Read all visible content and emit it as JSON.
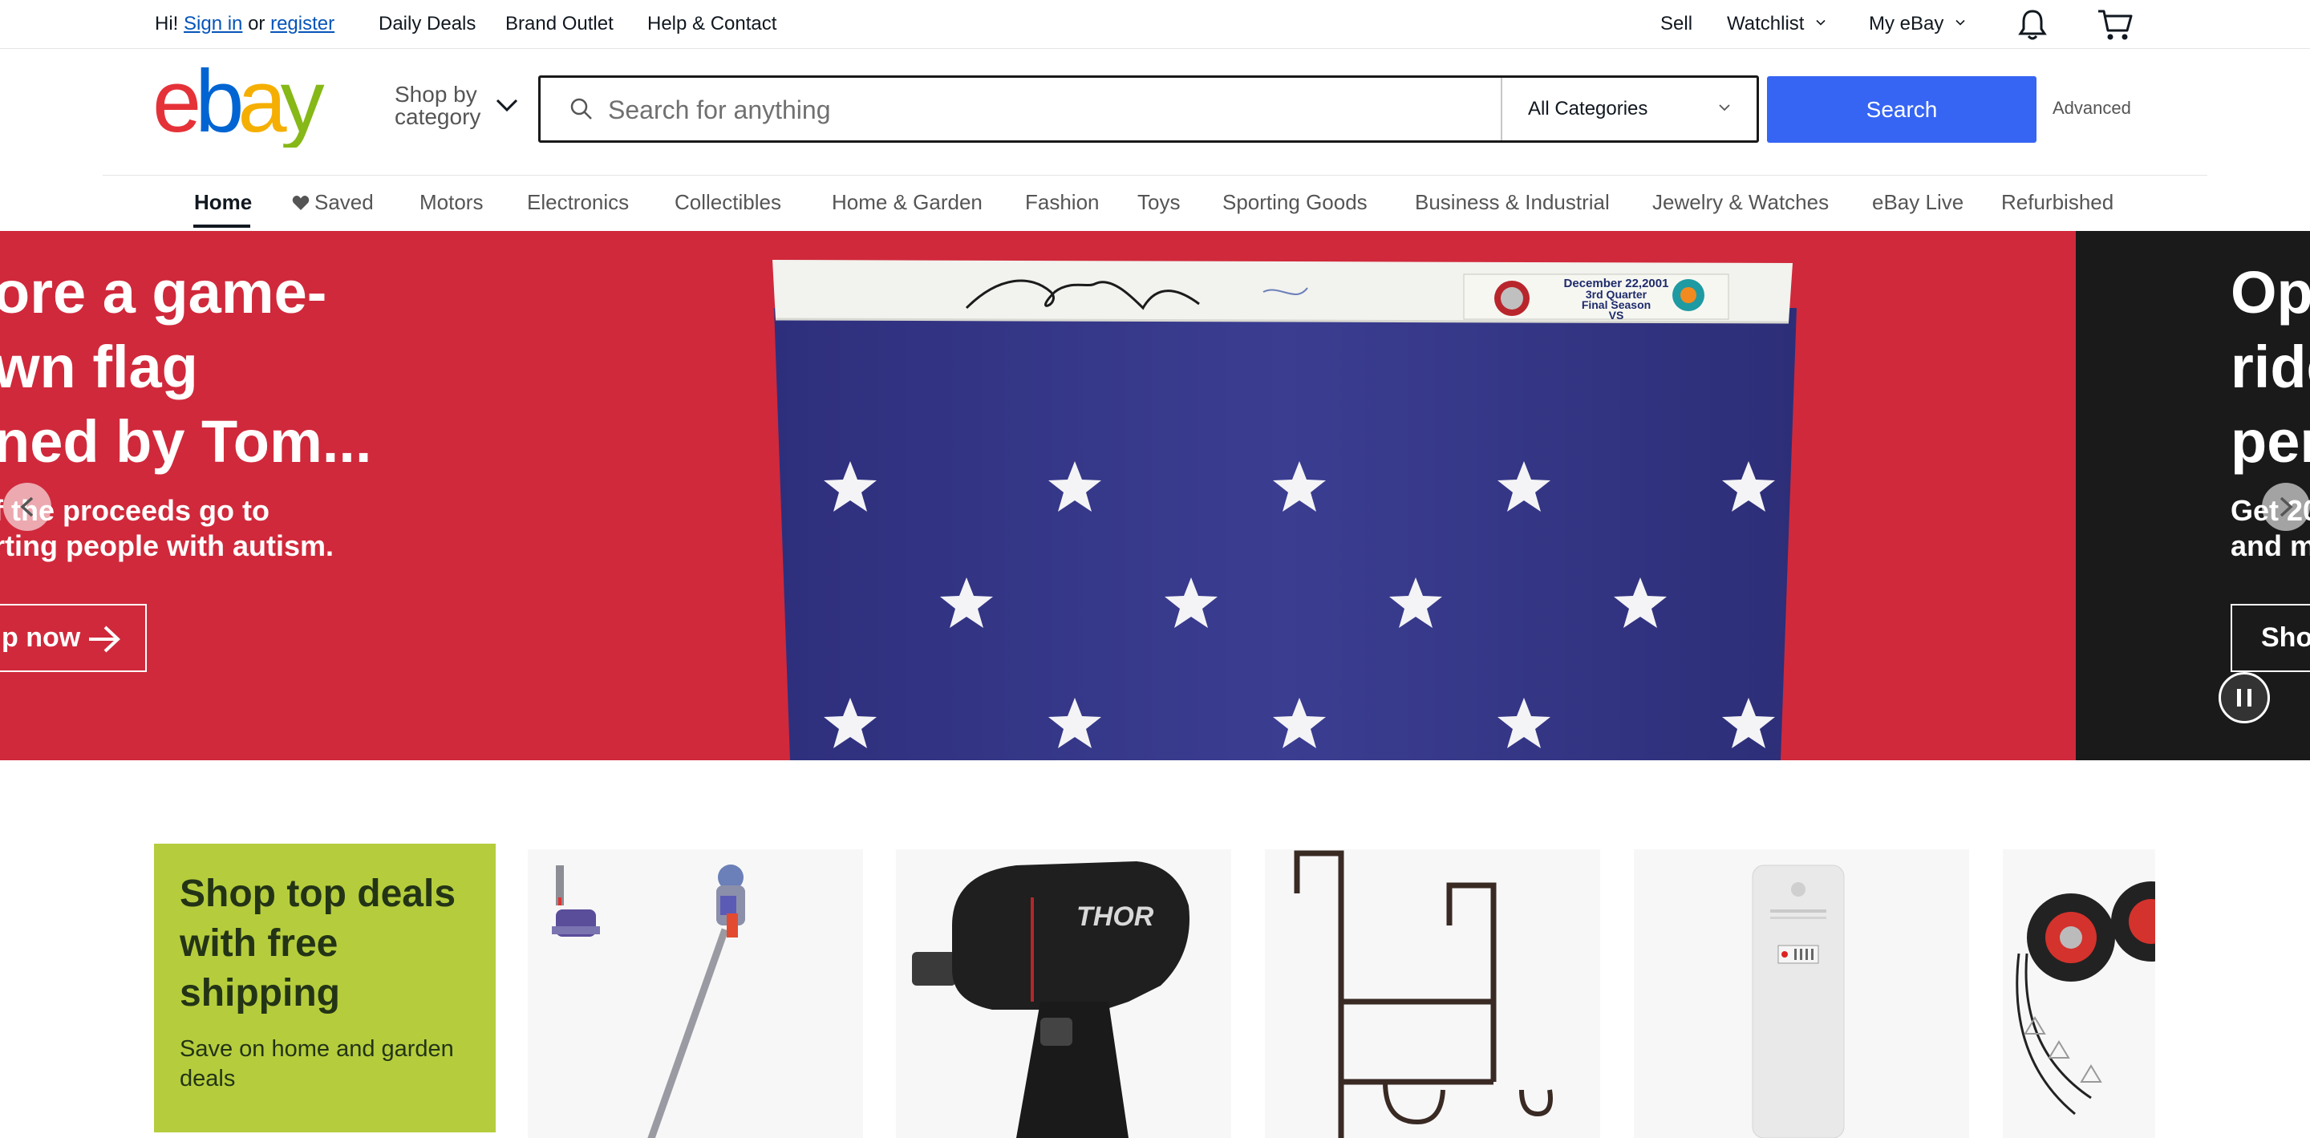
{
  "topbar": {
    "greeting": "Hi!",
    "sign_in": "Sign in",
    "or": "or",
    "register": "register",
    "links": [
      "Daily Deals",
      "Brand Outlet",
      "Help & Contact"
    ],
    "sell": "Sell",
    "watchlist": "Watchlist",
    "my_ebay": "My eBay"
  },
  "header": {
    "shop_by_category": "Shop by category",
    "search": {
      "placeholder": "Search for anything",
      "category": "All Categories",
      "button": "Search",
      "advanced": "Advanced"
    }
  },
  "nav": {
    "items": [
      "Home",
      "Saved",
      "Motors",
      "Electronics",
      "Collectibles",
      "Home & Garden",
      "Fashion",
      "Toys",
      "Sporting Goods",
      "Business & Industrial",
      "Jewelry & Watches",
      "eBay Live",
      "Refurbished"
    ],
    "active": "Home"
  },
  "hero": {
    "slide_current": {
      "title_lines": [
        "ore a game-",
        "wn flag",
        "ned by Tom..."
      ],
      "subtitle_lines": [
        "f the proceeds go to",
        "rting people with autism."
      ],
      "button": "p now"
    },
    "slide_next": {
      "title_lines": [
        "Op",
        "ride",
        "per"
      ],
      "subtitle_lines": [
        "Get 20",
        "and m"
      ],
      "button": "Shop"
    },
    "flag_text": [
      "December 22,2001",
      "3rd Quarter",
      "Final Season",
      "VS"
    ]
  },
  "deals": {
    "title": "Shop top deals with free shipping",
    "subtitle": "Save on home and garden deals",
    "thor_label": "THOR"
  },
  "colors": {
    "brand_blue": "#3665f3",
    "hero_red": "#d0293b",
    "deals_green": "#b5cd3c",
    "logo_e": "#e53238",
    "logo_b": "#0064d2",
    "logo_a": "#f5af02",
    "logo_y": "#86b817"
  },
  "icons": [
    "chevron-down-icon",
    "bell-icon",
    "cart-icon",
    "search-icon",
    "heart-icon",
    "arrow-right-icon",
    "chevron-left-icon",
    "chevron-right-icon",
    "pause-icon"
  ]
}
